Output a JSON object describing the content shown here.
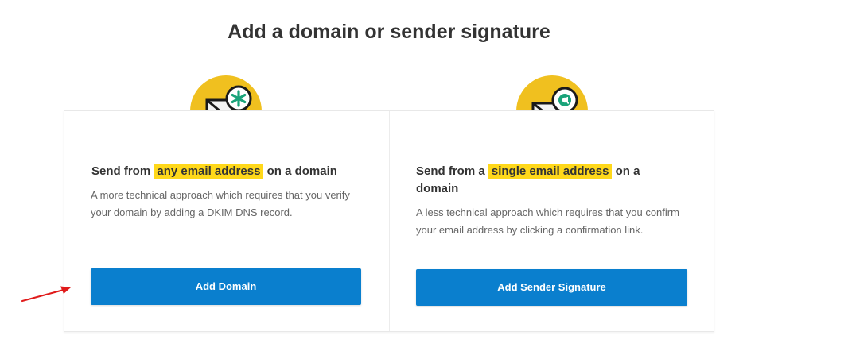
{
  "page": {
    "title": "Add a domain or sender signature"
  },
  "domain_card": {
    "heading_pre": "Send from",
    "heading_highlight": "any email address",
    "heading_post": "on a domain",
    "description": "A more technical approach which requires that you verify your domain by adding a DKIM DNS record.",
    "button_label": "Add Domain",
    "icon": "envelope-asterisk-icon"
  },
  "signature_card": {
    "heading_pre": "Send from a",
    "heading_highlight": "single email address",
    "heading_post": "on a domain",
    "description": "A less technical approach which requires that you confirm your email address by clicking a confirmation link.",
    "button_label": "Add Sender Signature",
    "icon": "envelope-at-icon"
  },
  "colors": {
    "accent_blue": "#0a7fce",
    "icon_yellow": "#f0c01f",
    "highlight_yellow": "#ffd81a",
    "badge_green": "#1aa37a",
    "annotation_red": "#e01b1b"
  }
}
